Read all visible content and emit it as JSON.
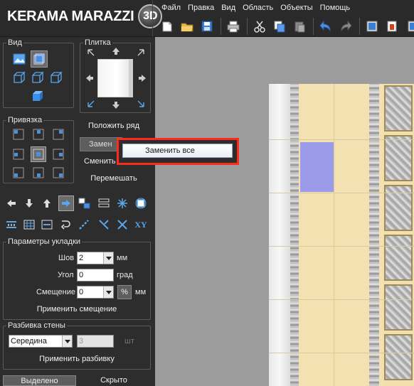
{
  "app": {
    "logo_text": "KERAMA MARAZZI",
    "logo_badge": "3D"
  },
  "menu": [
    "Файл",
    "Правка",
    "Вид",
    "Область",
    "Объекты",
    "Помощь"
  ],
  "toolbar_icons": [
    "new-document-icon",
    "open-folder-icon",
    "save-icon",
    "print-icon",
    "cut-icon",
    "copy-icon",
    "paste-icon",
    "undo-icon",
    "redo-icon",
    "render-view-icon",
    "exit-icon"
  ],
  "groups": {
    "view_title": "Вид",
    "tile_title": "Плитка",
    "snap_title": "Привязка",
    "layout_title": "Параметры укладки",
    "split_title": "Разбивка стены"
  },
  "buttons": {
    "lay_row": "Положить ряд",
    "replace": "Замен",
    "change": "Сменить",
    "shuffle": "Перемешать",
    "apply_offset": "Применить смещение",
    "apply_split": "Применить разбивку",
    "percent": "%"
  },
  "popup": {
    "replace_all": "Заменить все"
  },
  "layout": {
    "seam_label": "Шов",
    "seam_value": "2",
    "seam_unit": "мм",
    "angle_label": "Угол",
    "angle_value": "0",
    "angle_unit": "град",
    "offset_label": "Смещение",
    "offset_value": "0",
    "offset_unit": "мм"
  },
  "split": {
    "mode": "Середина",
    "count": "3",
    "count_unit": "шт"
  },
  "bottom_tabs": {
    "selected": "Выделено",
    "hidden": "Скрыто"
  },
  "colors": {
    "tile_cream": "#f3dfae",
    "tile_selected": "#9b9bea",
    "highlight_red": "#ff2a1a"
  }
}
